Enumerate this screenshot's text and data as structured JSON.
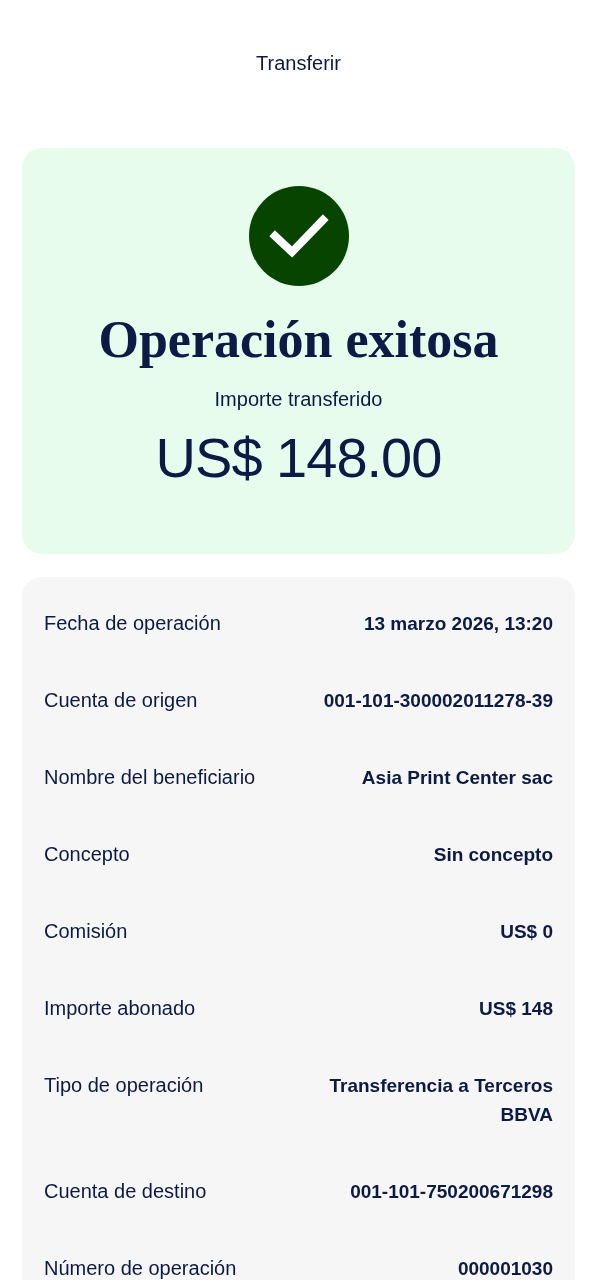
{
  "header": {
    "title": "Transferir"
  },
  "result": {
    "title": "Operación exitosa",
    "subtitle": "Importe transferido",
    "amount": "US$ 148.00"
  },
  "details": [
    {
      "label": "Fecha de operación",
      "value": "13 marzo 2026, 13:20"
    },
    {
      "label": "Cuenta de origen",
      "value": "001-101-300002011278-39"
    },
    {
      "label": "Nombre del beneficiario",
      "value": "Asia Print Center sac"
    },
    {
      "label": "Concepto",
      "value": "Sin concepto"
    },
    {
      "label": "Comisión",
      "value": "US$ 0"
    },
    {
      "label": "Importe abonado",
      "value": "US$ 148"
    },
    {
      "label": "Tipo de operación",
      "value": "Transferencia a Terceros BBVA"
    },
    {
      "label": "Cuenta de destino",
      "value": "001-101-750200671298"
    },
    {
      "label": "Número de operación",
      "value": "000001030"
    }
  ]
}
